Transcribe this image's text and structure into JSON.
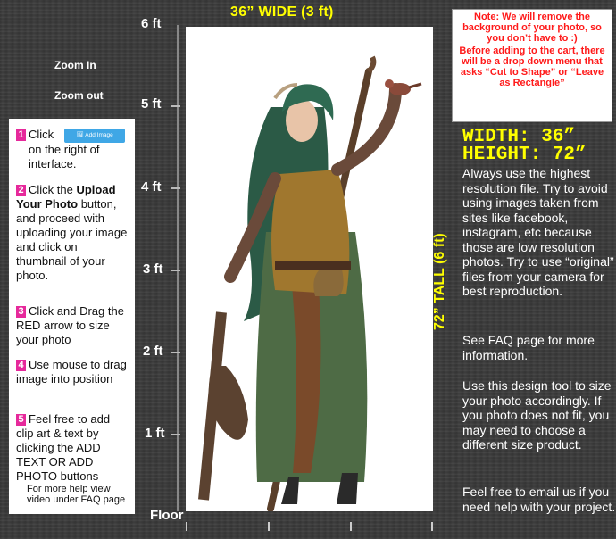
{
  "ruler": {
    "labels": [
      "6 ft",
      "5 ft",
      "4 ft",
      "3 ft",
      "2 ft",
      "1 ft",
      "Floor"
    ]
  },
  "canvas": {
    "width_label": "36” WIDE (3 ft)",
    "height_label": "72” TALL (6 ft)"
  },
  "zoom": {
    "in": "Zoom In",
    "out": "Zoom out"
  },
  "instructions": {
    "step1_pre": "Click",
    "add_image_button": "Add Image",
    "step1_post": "on the right of interface.",
    "step2_pre": "Click the ",
    "step2_bold": "Upload Your Photo",
    "step2_post": " button, and proceed with uploading your image and click on thumbnail of your photo.",
    "step3": "Click and Drag the RED arrow to size your photo",
    "step4": "Use mouse to drag image into position",
    "step5": "Feel free to add clip art & text by clicking the ADD TEXT OR ADD PHOTO buttons",
    "help": "For more help view video under FAQ page",
    "numbers": [
      "1",
      "2",
      "3",
      "4",
      "5"
    ]
  },
  "note": {
    "line1": "Note: We will remove the background of your photo, so you don’t have to :)",
    "line2": "Before adding to the cart, there will be a drop down menu that asks “Cut to Shape” or “Leave as Rectangle”"
  },
  "dimensions": {
    "width": "WIDTH: 36”",
    "height": "HEIGHT: 72”"
  },
  "info": {
    "p1": "Always use the highest resolution file. Try to avoid using images taken from sites like facebook, instagram, etc because those are low resolution photos. Try to use “original” files from your camera for best reproduction.",
    "p2": "See FAQ page for more information.",
    "p3": "Use this design tool to size your photo accordingly.  If you photo does not fit, you may need to choose a different size product.",
    "p4": "Feel free to email us if you need help with your project."
  },
  "colors": {
    "accent": "#ffff00",
    "note_red": "#ff1a1a",
    "step_pink": "#e6299b",
    "button_blue": "#3fa7e6"
  }
}
